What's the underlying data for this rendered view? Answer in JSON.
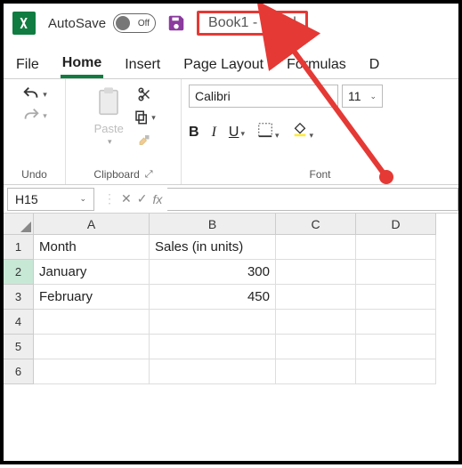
{
  "titlebar": {
    "autosave_label": "AutoSave",
    "autosave_state": "Off",
    "doc_title": "Book1  -  Excel"
  },
  "menu": {
    "file": "File",
    "home": "Home",
    "insert": "Insert",
    "page_layout": "Page Layout",
    "formulas": "Formulas",
    "data_partial": "D"
  },
  "ribbon": {
    "undo_group": "Undo",
    "clipboard_group": "Clipboard",
    "paste_label": "Paste",
    "font_group": "Font",
    "font_name": "Calibri",
    "font_size": "11",
    "bold": "B",
    "italic": "I",
    "underline": "U"
  },
  "formula_bar": {
    "name_box": "H15",
    "fx_label": "fx",
    "formula_value": ""
  },
  "grid": {
    "columns": [
      "A",
      "B",
      "C",
      "D"
    ],
    "rows": [
      "1",
      "2",
      "3",
      "4",
      "5",
      "6"
    ],
    "cells": {
      "A1": "Month",
      "B1": "Sales (in units)",
      "A2": "January",
      "B2": "300",
      "A3": "February",
      "B3": "450"
    },
    "selected_row": "2"
  }
}
